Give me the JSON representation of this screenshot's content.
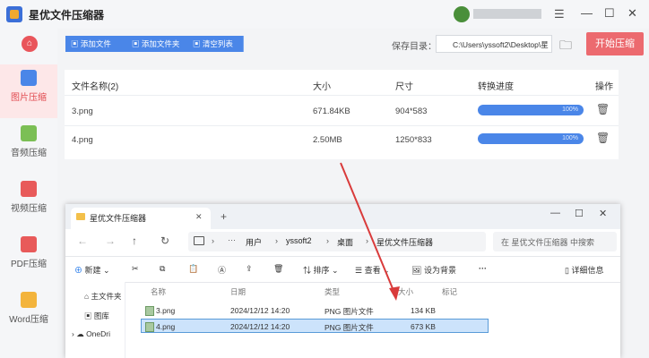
{
  "app": {
    "title": "星优文件压缩器",
    "menu_icon": "menu-icon",
    "minimize": "—",
    "maximize": "☐",
    "close": "✕"
  },
  "sidebar": {
    "home_icon": "⌂",
    "items": [
      {
        "label": "图片压缩",
        "active": true,
        "color": "#4a86e8"
      },
      {
        "label": "音频压缩",
        "active": false,
        "color": "#7bbf55"
      },
      {
        "label": "视频压缩",
        "active": false,
        "color": "#e85a5a"
      },
      {
        "label": "PDF压缩",
        "active": false,
        "color": "#e85a5a"
      },
      {
        "label": "Word压缩",
        "active": false,
        "color": "#f3b43c"
      }
    ]
  },
  "toolbar": {
    "add_file": "添加文件",
    "add_folder": "添加文件夹",
    "clear_list": "清空列表",
    "save_dir_label": "保存目录：",
    "save_dir_value": "C:\\Users\\yssoft2\\Desktop\\星",
    "start_button": "开始压缩"
  },
  "table": {
    "headers": [
      "文件名称(2)",
      "大小",
      "尺寸",
      "转换进度",
      "操作"
    ],
    "rows": [
      {
        "name": "3.png",
        "size": "671.84KB",
        "dims": "904*583",
        "progress_label": "100%",
        "progress": 1.0
      },
      {
        "name": "4.png",
        "size": "2.50MB",
        "dims": "1250*833",
        "progress_label": "100%",
        "progress": 1.0
      }
    ]
  },
  "explorer": {
    "tab_title": "星优文件压缩器",
    "tab_close": "✕",
    "new_tab": "+",
    "breadcrumb": [
      "用户",
      "yssoft2",
      "桌面",
      "星优文件压缩器"
    ],
    "search_placeholder": "在 星优文件压缩器 中搜索",
    "commands": {
      "new": "新建",
      "sort": "排序",
      "view": "查看",
      "set_bg": "设为背景",
      "more": "···",
      "details": "详细信息"
    },
    "nav_items": [
      "主文件夹",
      "图库",
      "OneDri"
    ],
    "columns": [
      "名称",
      "日期",
      "类型",
      "大小",
      "标记"
    ],
    "files": [
      {
        "name": "3.png",
        "date": "2024/12/12 14:20",
        "type": "PNG 图片文件",
        "size": "134 KB",
        "selected": false
      },
      {
        "name": "4.png",
        "date": "2024/12/12 14:20",
        "type": "PNG 图片文件",
        "size": "673 KB",
        "selected": true
      }
    ]
  },
  "accent_color": "#4a86e8",
  "start_color": "#ec6a6f"
}
